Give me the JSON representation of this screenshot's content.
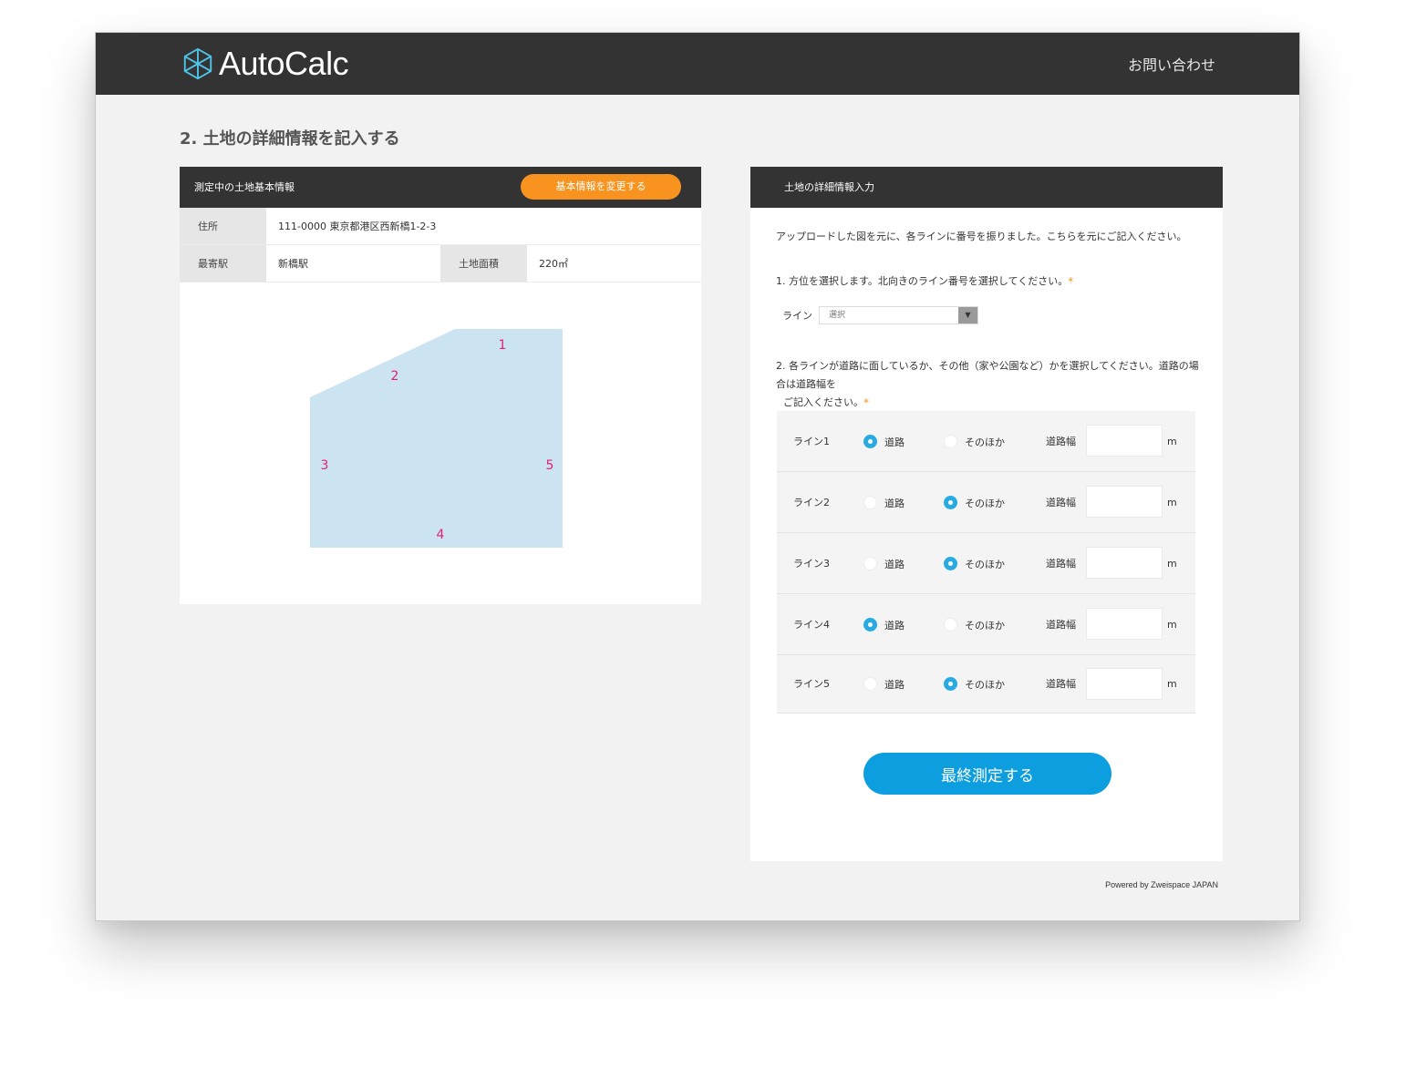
{
  "header": {
    "logo_text": "AutoCalc",
    "contact_label": "お問い合わせ"
  },
  "page_title": "2. 土地の詳細情報を記入する",
  "land_info": {
    "card_title": "測定中の土地基本情報",
    "change_button": "基本情報を変更する",
    "address_label": "住所",
    "address_value": "111-0000 東京都港区西新橋1-2-3",
    "station_label": "最寄駅",
    "station_value": "新橋駅",
    "area_label": "土地面積",
    "area_value": "220㎡",
    "plot_color": "#cce4f2",
    "line_number_color": "#e0207a",
    "line_numbers": [
      "1",
      "2",
      "3",
      "4",
      "5"
    ]
  },
  "detail_form": {
    "card_title": "土地の詳細情報入力",
    "intro": "アップロードした図を元に、各ラインに番号を振りました。こちらを元にご記入ください。",
    "q1": "1. 方位を選択します。北向きのライン番号を選択してください。",
    "q1_required": "*",
    "line_label": "ライン",
    "select_value": "選択",
    "q2_line1": "2. 各ラインが道路に面しているか、その他（家や公園など）かを選択してください。道路の場合は道路幅を",
    "q2_line2": "ご記入ください。",
    "q2_required": "*",
    "road_label": "道路",
    "other_label": "そのほか",
    "width_label": "道路幅",
    "unit": "m",
    "lines": [
      {
        "name": "ライン1",
        "selected": "road"
      },
      {
        "name": "ライン2",
        "selected": "other"
      },
      {
        "name": "ライン3",
        "selected": "other"
      },
      {
        "name": "ライン4",
        "selected": "road"
      },
      {
        "name": "ライン5",
        "selected": "other"
      }
    ],
    "submit_label": "最終測定する",
    "accent_color": "#29abe2"
  },
  "footer": {
    "powered_by": "Powered by Zweispace JAPAN"
  }
}
